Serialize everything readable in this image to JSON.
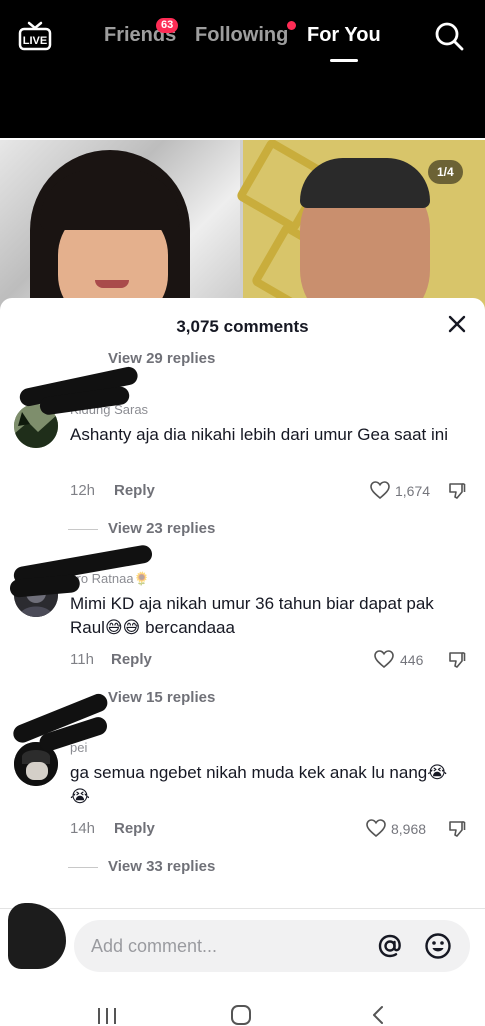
{
  "topbar": {
    "live_label": "LIVE",
    "tabs": [
      {
        "label": "Friends",
        "badge": "63"
      },
      {
        "label": "Following"
      },
      {
        "label": "For You"
      }
    ]
  },
  "video": {
    "image_counter": "1/4"
  },
  "comments_sheet": {
    "title": "3,075 comments",
    "top_view_replies": "View 29 replies",
    "comments": [
      {
        "username": "Kidung Saras",
        "text": "Ashanty aja dia nikahi lebih dari umur Gea saat ini",
        "time": "12h",
        "reply_label": "Reply",
        "likes": "1,674",
        "view_replies": "View 23 replies"
      },
      {
        "username": "Jro Ratnaa🌻",
        "text": "Mimi KD aja nikah umur 36 tahun biar dapat pak Raul😅😅 bercandaaa",
        "time": "11h",
        "reply_label": "Reply",
        "likes": "446",
        "view_replies": "View 15 replies"
      },
      {
        "username": "pei",
        "text": "ga semua ngebet nikah muda kek anak lu nang😭😭",
        "time": "14h",
        "reply_label": "Reply",
        "likes": "8,968",
        "view_replies": "View 33 replies"
      }
    ]
  },
  "composer": {
    "placeholder": "Add comment..."
  },
  "colors": {
    "accent": "#fe2c55",
    "text": "#161823"
  }
}
